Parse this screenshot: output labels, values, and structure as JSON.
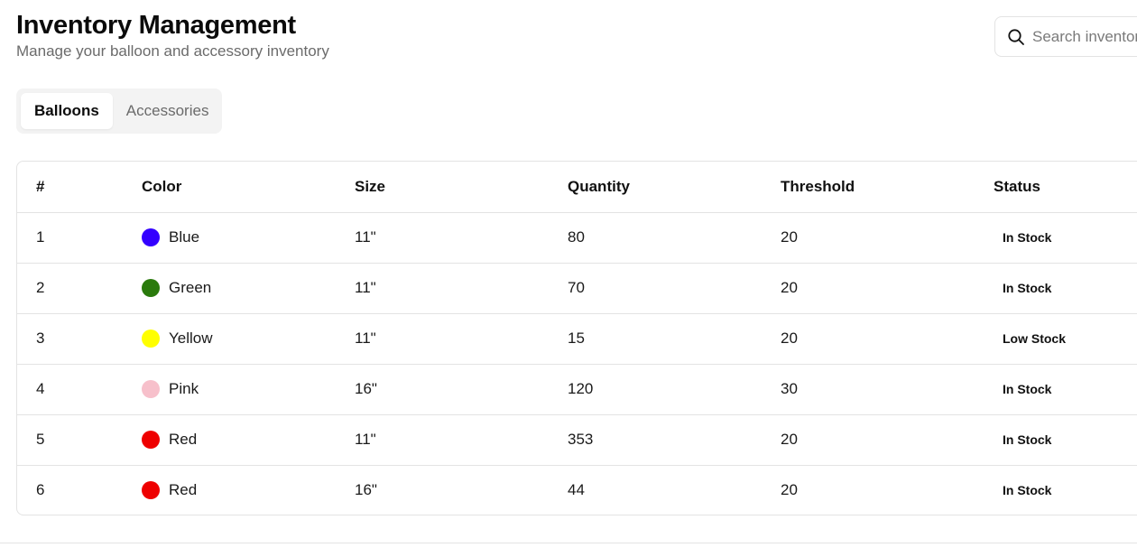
{
  "header": {
    "title": "Inventory Management",
    "subtitle": "Manage your balloon and accessory inventory"
  },
  "search": {
    "placeholder": "Search inventory...",
    "icon": "search-icon"
  },
  "tabs": [
    {
      "label": "Balloons",
      "active": true
    },
    {
      "label": "Accessories",
      "active": false
    }
  ],
  "table": {
    "columns": [
      "#",
      "Color",
      "Size",
      "Quantity",
      "Threshold",
      "Status"
    ],
    "rows": [
      {
        "num": "1",
        "color": "Blue",
        "swatch": "#3300ff",
        "size": "11\"",
        "quantity": "80",
        "threshold": "20",
        "status": "In Stock"
      },
      {
        "num": "2",
        "color": "Green",
        "swatch": "#2a7a0c",
        "size": "11\"",
        "quantity": "70",
        "threshold": "20",
        "status": "In Stock"
      },
      {
        "num": "3",
        "color": "Yellow",
        "swatch": "#ffff00",
        "size": "11\"",
        "quantity": "15",
        "threshold": "20",
        "status": "Low Stock"
      },
      {
        "num": "4",
        "color": "Pink",
        "swatch": "#f7c0cb",
        "size": "16\"",
        "quantity": "120",
        "threshold": "30",
        "status": "In Stock"
      },
      {
        "num": "5",
        "color": "Red",
        "swatch": "#ee0000",
        "size": "11\"",
        "quantity": "353",
        "threshold": "20",
        "status": "In Stock"
      },
      {
        "num": "6",
        "color": "Red",
        "swatch": "#ee0000",
        "size": "16\"",
        "quantity": "44",
        "threshold": "20",
        "status": "In Stock"
      }
    ]
  }
}
